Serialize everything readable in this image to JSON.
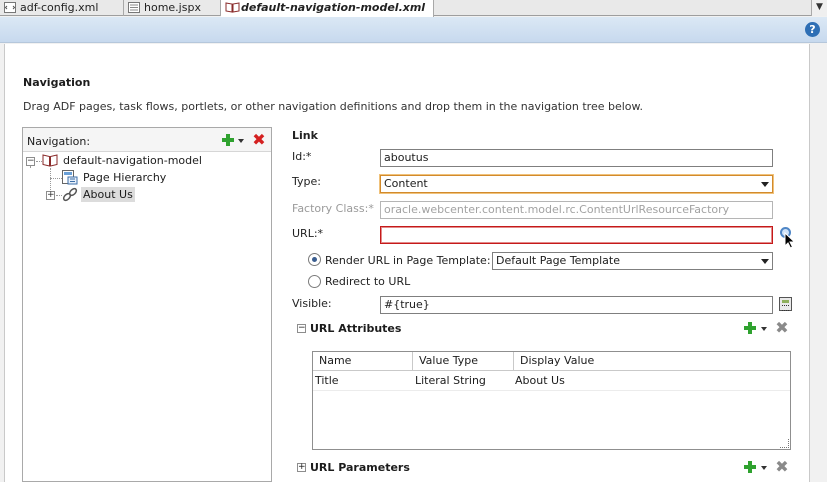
{
  "tabs": [
    {
      "label": "adf-config.xml",
      "icon": "xml-file-icon"
    },
    {
      "label": "home.jspx",
      "icon": "jspx-file-icon"
    },
    {
      "label": "default-navigation-model.xml",
      "icon": "navigation-model-icon",
      "active": true
    }
  ],
  "help_label": "?",
  "page": {
    "heading": "Navigation",
    "description": "Drag ADF pages, task flows, portlets, or other navigation definitions and drop them in the navigation tree below."
  },
  "tree": {
    "title": "Navigation:",
    "root": {
      "label": "default-navigation-model"
    },
    "children": [
      {
        "label": "Page Hierarchy"
      },
      {
        "label": "About Us",
        "selected": true
      }
    ]
  },
  "form": {
    "section_title": "Link",
    "id_label": "Id:*",
    "id_value": "aboutus",
    "type_label": "Type:",
    "type_value": "Content",
    "factory_label": "Factory Class:*",
    "factory_value": "oracle.webcenter.content.model.rc.ContentUrlResourceFactory",
    "url_label": "URL:*",
    "url_value": "",
    "render_label": "Render URL in Page Template:",
    "template_value": "Default Page Template",
    "redirect_label": "Redirect to URL",
    "visible_label": "Visible:",
    "visible_value": "#{true}"
  },
  "url_attributes": {
    "title": "URL Attributes",
    "columns": [
      "Name",
      "Value Type",
      "Display Value"
    ],
    "rows": [
      {
        "name": "Title",
        "value_type": "Literal String",
        "display_value": "About Us"
      }
    ]
  },
  "url_parameters": {
    "title": "URL Parameters"
  },
  "colors": {
    "accent_blue": "#2e6fb5",
    "add_green": "#2fa22f",
    "delete_red": "#d42020",
    "error_border": "#c51a1a",
    "focus_orange": "#d28a2c"
  }
}
